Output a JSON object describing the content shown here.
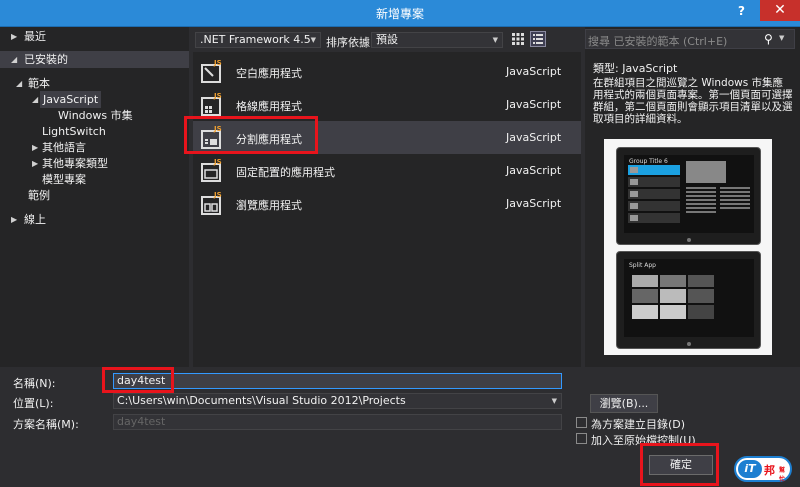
{
  "window": {
    "title": "新增專案",
    "help_label": "?",
    "close_label": "✕"
  },
  "tree": {
    "recent": "最近",
    "installed": "已安裝的",
    "templates": "範本",
    "javascript": "JavaScript",
    "windows_store": "Windows 市集",
    "lightswitch": "LightSwitch",
    "other_languages": "其他語言",
    "other_project_types": "其他專案類型",
    "modeling_projects": "模型專案",
    "samples": "範例",
    "online": "線上"
  },
  "toolbar": {
    "framework": ".NET Framework 4.5",
    "sort_label": "排序依據:",
    "sort_value": "預設"
  },
  "templates": [
    {
      "name": "空白應用程式",
      "lang": "JavaScript",
      "icon": "blank-app-icon"
    },
    {
      "name": "格線應用程式",
      "lang": "JavaScript",
      "icon": "grid-app-icon"
    },
    {
      "name": "分割應用程式",
      "lang": "JavaScript",
      "icon": "split-app-icon"
    },
    {
      "name": "固定配置的應用程式",
      "lang": "JavaScript",
      "icon": "fixed-layout-app-icon"
    },
    {
      "name": "瀏覽應用程式",
      "lang": "JavaScript",
      "icon": "navigation-app-icon"
    }
  ],
  "details": {
    "search_placeholder": "搜尋 已安裝的範本 (Ctrl+E)",
    "type_line": "類型: JavaScript",
    "description": "在群組項目之間巡覽之 Windows 市集應用程式的兩個頁面專案。第一個頁面可選擇群組，第二個頁面則會顯示項目清單以及選取項目的詳細資料。",
    "preview_top_title": "Group Title 6",
    "preview_bottom_title": "Split App"
  },
  "form": {
    "name_label": "名稱(N):",
    "name_value": "day4test",
    "location_label": "位置(L):",
    "location_value": "C:\\Users\\win\\Documents\\Visual Studio 2012\\Projects",
    "solution_label": "方案名稱(M):",
    "solution_value": "day4test",
    "browse_label": "瀏覽(B)...",
    "create_dir_label": "為方案建立目錄(D)",
    "add_source_control_label": "加入至原始檔控制(U)",
    "ok_label": "確定"
  },
  "watermark": {
    "logo_text": "iT邦幫忙"
  },
  "colors": {
    "titlebar": "#2b8ad8",
    "highlight": "#e8141c",
    "selection": "#3f3f46"
  }
}
